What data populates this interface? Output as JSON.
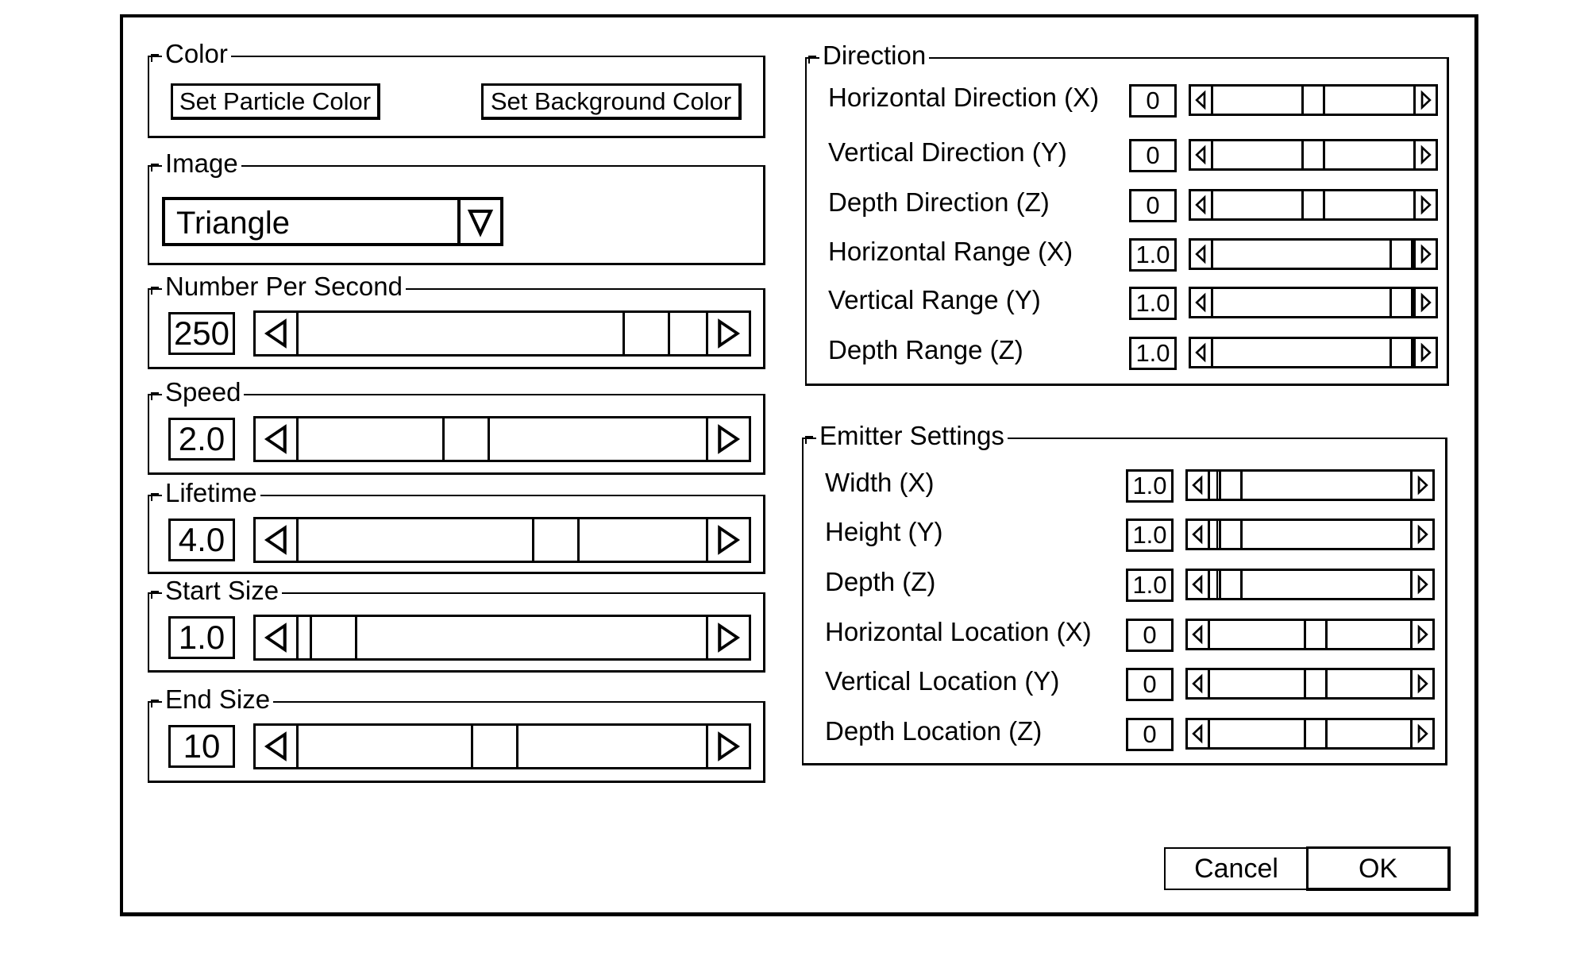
{
  "color_group": {
    "title": "Color",
    "particle_button": "Set Particle Color",
    "background_button": "Set Background Color"
  },
  "image_group": {
    "title": "Image",
    "selected": "Triangle",
    "dropdown_icon": "triangle-down"
  },
  "left_sliders": [
    {
      "title": "Number Per Second",
      "value": "250",
      "position": 0.9
    },
    {
      "title": "Speed",
      "value": "2.0",
      "position": 0.4
    },
    {
      "title": "Lifetime",
      "value": "4.0",
      "position": 0.65
    },
    {
      "title": "Start Size",
      "value": "1.0",
      "position": 0.03
    },
    {
      "title": "End Size",
      "value": "10",
      "position": 0.48
    }
  ],
  "direction_group": {
    "title": "Direction",
    "rows": [
      {
        "label": "Horizontal Direction (X)",
        "value": "0",
        "position": 0.5
      },
      {
        "label": "Vertical Direction (Y)",
        "value": "0",
        "position": 0.5
      },
      {
        "label": "Depth Direction (Z)",
        "value": "0",
        "position": 0.5
      },
      {
        "label": "Horizontal Range (X)",
        "value": "1.0",
        "position": 1.0
      },
      {
        "label": "Vertical Range (Y)",
        "value": "1.0",
        "position": 1.0
      },
      {
        "label": "Depth Range (Z)",
        "value": "1.0",
        "position": 1.0
      }
    ]
  },
  "emitter_group": {
    "title": "Emitter Settings",
    "rows": [
      {
        "label": "Width (X)",
        "value": "1.0",
        "position": 0.05,
        "tick": true
      },
      {
        "label": "Height (Y)",
        "value": "1.0",
        "position": 0.05,
        "tick": true
      },
      {
        "label": "Depth (Z)",
        "value": "1.0",
        "position": 0.05,
        "tick": true
      },
      {
        "label": "Horizontal Location (X)",
        "value": "0",
        "position": 0.53,
        "tick": false
      },
      {
        "label": "Vertical Location (Y)",
        "value": "0",
        "position": 0.53,
        "tick": false
      },
      {
        "label": "Depth Location (Z)",
        "value": "0",
        "position": 0.53,
        "tick": false
      }
    ]
  },
  "footer": {
    "cancel": "Cancel",
    "ok": "OK"
  },
  "icons": {
    "slider_left": "triangle-left",
    "slider_right": "triangle-right"
  }
}
